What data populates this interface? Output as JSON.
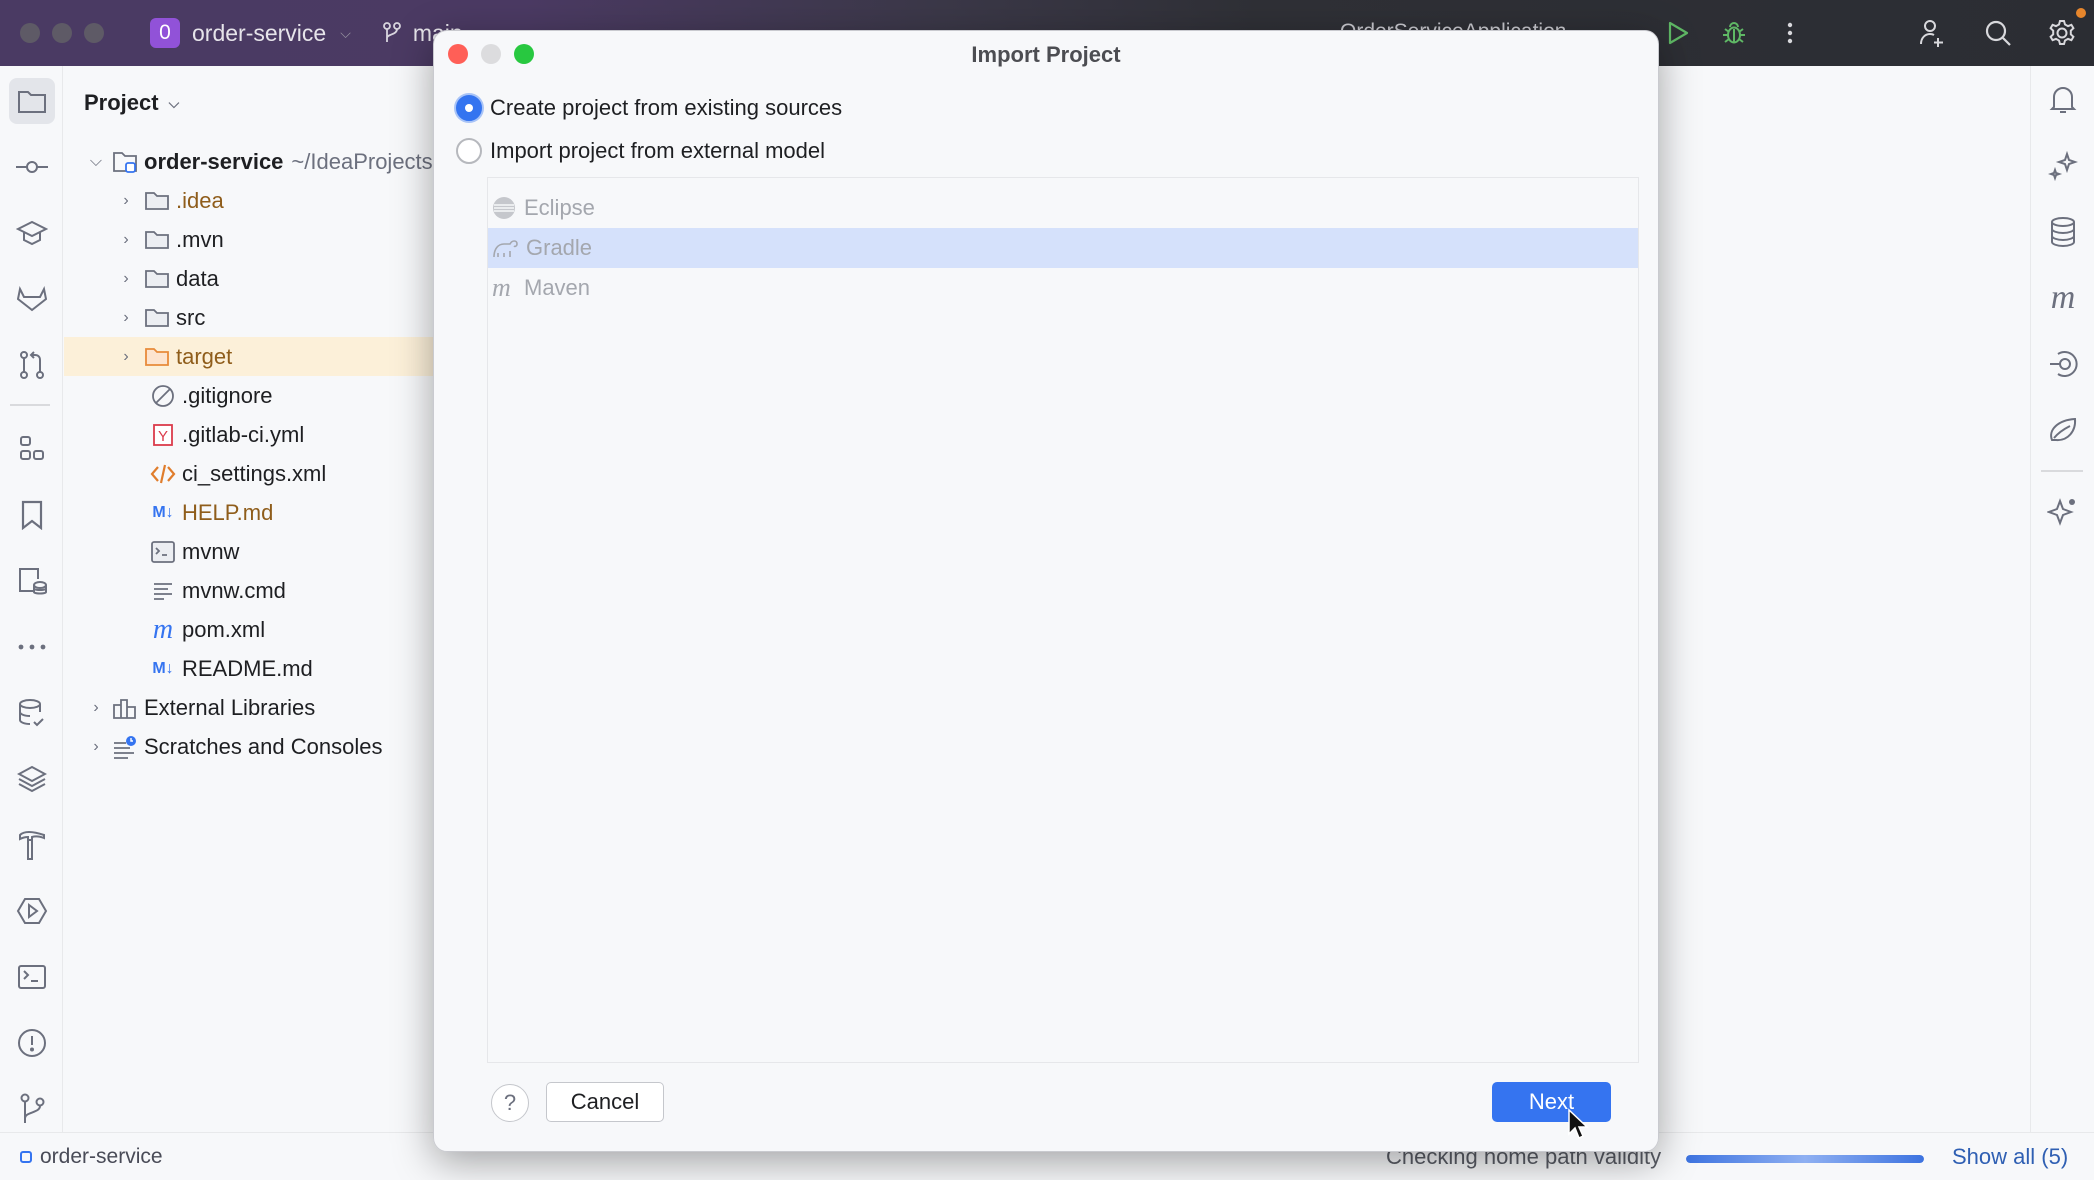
{
  "titlebar": {
    "project_badge": "0",
    "project_name": "order-service",
    "branch": "main",
    "run_config": "OrderServiceApplication",
    "icons": [
      "run-icon",
      "debug-icon",
      "more-icon",
      "add-user-icon",
      "search-icon",
      "settings-icon"
    ],
    "colors": {
      "badge": "#9152d8",
      "run": "#5fb865",
      "settings_dot": "#e7862c"
    }
  },
  "left_stripe": {
    "icons": [
      "project-icon",
      "commit-icon",
      "learn-icon",
      "gitlab-icon",
      "pull-requests-icon",
      "structure-icon",
      "bookmarks-icon",
      "database-file-icon",
      "more-tools-icon",
      "database-check-icon",
      "layers-icon",
      "build-icon",
      "services-icon",
      "terminal-icon",
      "problems-icon",
      "git-icon"
    ]
  },
  "project_panel": {
    "title": "Project",
    "tree": [
      {
        "label": "order-service",
        "path": "~/IdeaProjects",
        "type": "root",
        "expanded": true
      },
      {
        "label": ".idea",
        "type": "folder"
      },
      {
        "label": ".mvn",
        "type": "folder"
      },
      {
        "label": "data",
        "type": "folder"
      },
      {
        "label": "src",
        "type": "folder"
      },
      {
        "label": "target",
        "type": "folder-excluded",
        "highlighted": true
      },
      {
        "label": ".gitignore",
        "type": "ignore"
      },
      {
        "label": ".gitlab-ci.yml",
        "type": "yaml"
      },
      {
        "label": "ci_settings.xml",
        "type": "xml"
      },
      {
        "label": "HELP.md",
        "type": "markdown"
      },
      {
        "label": "mvnw",
        "type": "shell"
      },
      {
        "label": "mvnw.cmd",
        "type": "text"
      },
      {
        "label": "pom.xml",
        "type": "maven"
      },
      {
        "label": "README.md",
        "type": "markdown"
      },
      {
        "label": "External Libraries",
        "type": "libraries"
      },
      {
        "label": "Scratches and Consoles",
        "type": "scratches"
      }
    ]
  },
  "right_stripe": {
    "icons": [
      "notifications-icon",
      "ai-sparkle-icon",
      "database-icon",
      "maven-icon",
      "endpoints-icon",
      "spring-icon",
      "ai-assistant-icon"
    ]
  },
  "dialog": {
    "title": "Import Project",
    "options": [
      {
        "label": "Create project from existing sources",
        "checked": true
      },
      {
        "label": "Import project from external model",
        "checked": false
      }
    ],
    "models": [
      {
        "label": "Eclipse",
        "selected": false
      },
      {
        "label": "Gradle",
        "selected": true
      },
      {
        "label": "Maven",
        "selected": false
      }
    ],
    "help_label": "?",
    "cancel_label": "Cancel",
    "next_label": "Next"
  },
  "statusbar": {
    "project": "order-service",
    "task": "Checking home path validity",
    "progress": 1.0,
    "show_all": "Show all (5)"
  }
}
